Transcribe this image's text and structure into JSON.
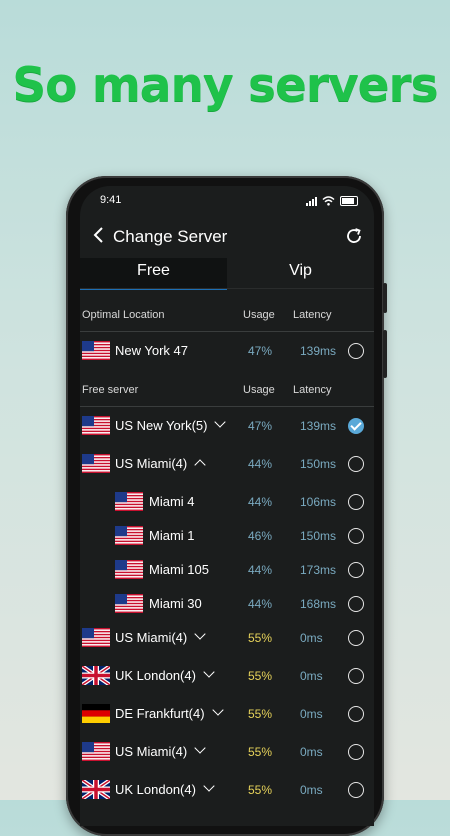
{
  "headline": "So many servers",
  "status": {
    "time": "9:41"
  },
  "nav": {
    "title": "Change Server"
  },
  "tabs": [
    {
      "label": "Free",
      "active": true
    },
    {
      "label": "Vip",
      "active": false
    }
  ],
  "optimal": {
    "header": {
      "name": "Optimal Location",
      "usage": "Usage",
      "latency": "Latency"
    },
    "row": {
      "flag": "us",
      "name": "New York 47",
      "usage": "47%",
      "latency": "139ms",
      "selected": false
    }
  },
  "free": {
    "header": {
      "name": "Free server",
      "usage": "Usage",
      "latency": "Latency"
    },
    "rows": [
      {
        "flag": "us",
        "name": "US New York(5)",
        "chevron": "down",
        "usage": "47%",
        "latency": "139ms",
        "usage_color": "blue",
        "selected": true,
        "sub": false
      },
      {
        "flag": "us",
        "name": "US Miami(4)",
        "chevron": "up",
        "usage": "44%",
        "latency": "150ms",
        "usage_color": "blue",
        "selected": false,
        "sub": false
      },
      {
        "flag": "us",
        "name": "Miami 4",
        "chevron": "",
        "usage": "44%",
        "latency": "106ms",
        "usage_color": "blue",
        "selected": false,
        "sub": true
      },
      {
        "flag": "us",
        "name": "Miami 1",
        "chevron": "",
        "usage": "46%",
        "latency": "150ms",
        "usage_color": "blue",
        "selected": false,
        "sub": true
      },
      {
        "flag": "us",
        "name": "Miami 105",
        "chevron": "",
        "usage": "44%",
        "latency": "173ms",
        "usage_color": "blue",
        "selected": false,
        "sub": true
      },
      {
        "flag": "us",
        "name": "Miami 30",
        "chevron": "",
        "usage": "44%",
        "latency": "168ms",
        "usage_color": "blue",
        "selected": false,
        "sub": true
      },
      {
        "flag": "us",
        "name": "US Miami(4)",
        "chevron": "down",
        "usage": "55%",
        "latency": "0ms",
        "usage_color": "yellow",
        "selected": false,
        "sub": false
      },
      {
        "flag": "uk",
        "name": "UK London(4)",
        "chevron": "down",
        "usage": "55%",
        "latency": "0ms",
        "usage_color": "yellow",
        "selected": false,
        "sub": false
      },
      {
        "flag": "de",
        "name": "DE Frankfurt(4)",
        "chevron": "down",
        "usage": "55%",
        "latency": "0ms",
        "usage_color": "yellow",
        "selected": false,
        "sub": false
      },
      {
        "flag": "us",
        "name": "US Miami(4)",
        "chevron": "down",
        "usage": "55%",
        "latency": "0ms",
        "usage_color": "yellow",
        "selected": false,
        "sub": false
      },
      {
        "flag": "uk",
        "name": "UK London(4)",
        "chevron": "down",
        "usage": "55%",
        "latency": "0ms",
        "usage_color": "yellow",
        "selected": false,
        "sub": false
      }
    ]
  },
  "colors": {
    "accent": "#1d6fb5",
    "headline": "#1fc24a",
    "usage_blue": "#7aaac0",
    "usage_yellow": "#e6d25a",
    "check": "#5aa9d8"
  }
}
